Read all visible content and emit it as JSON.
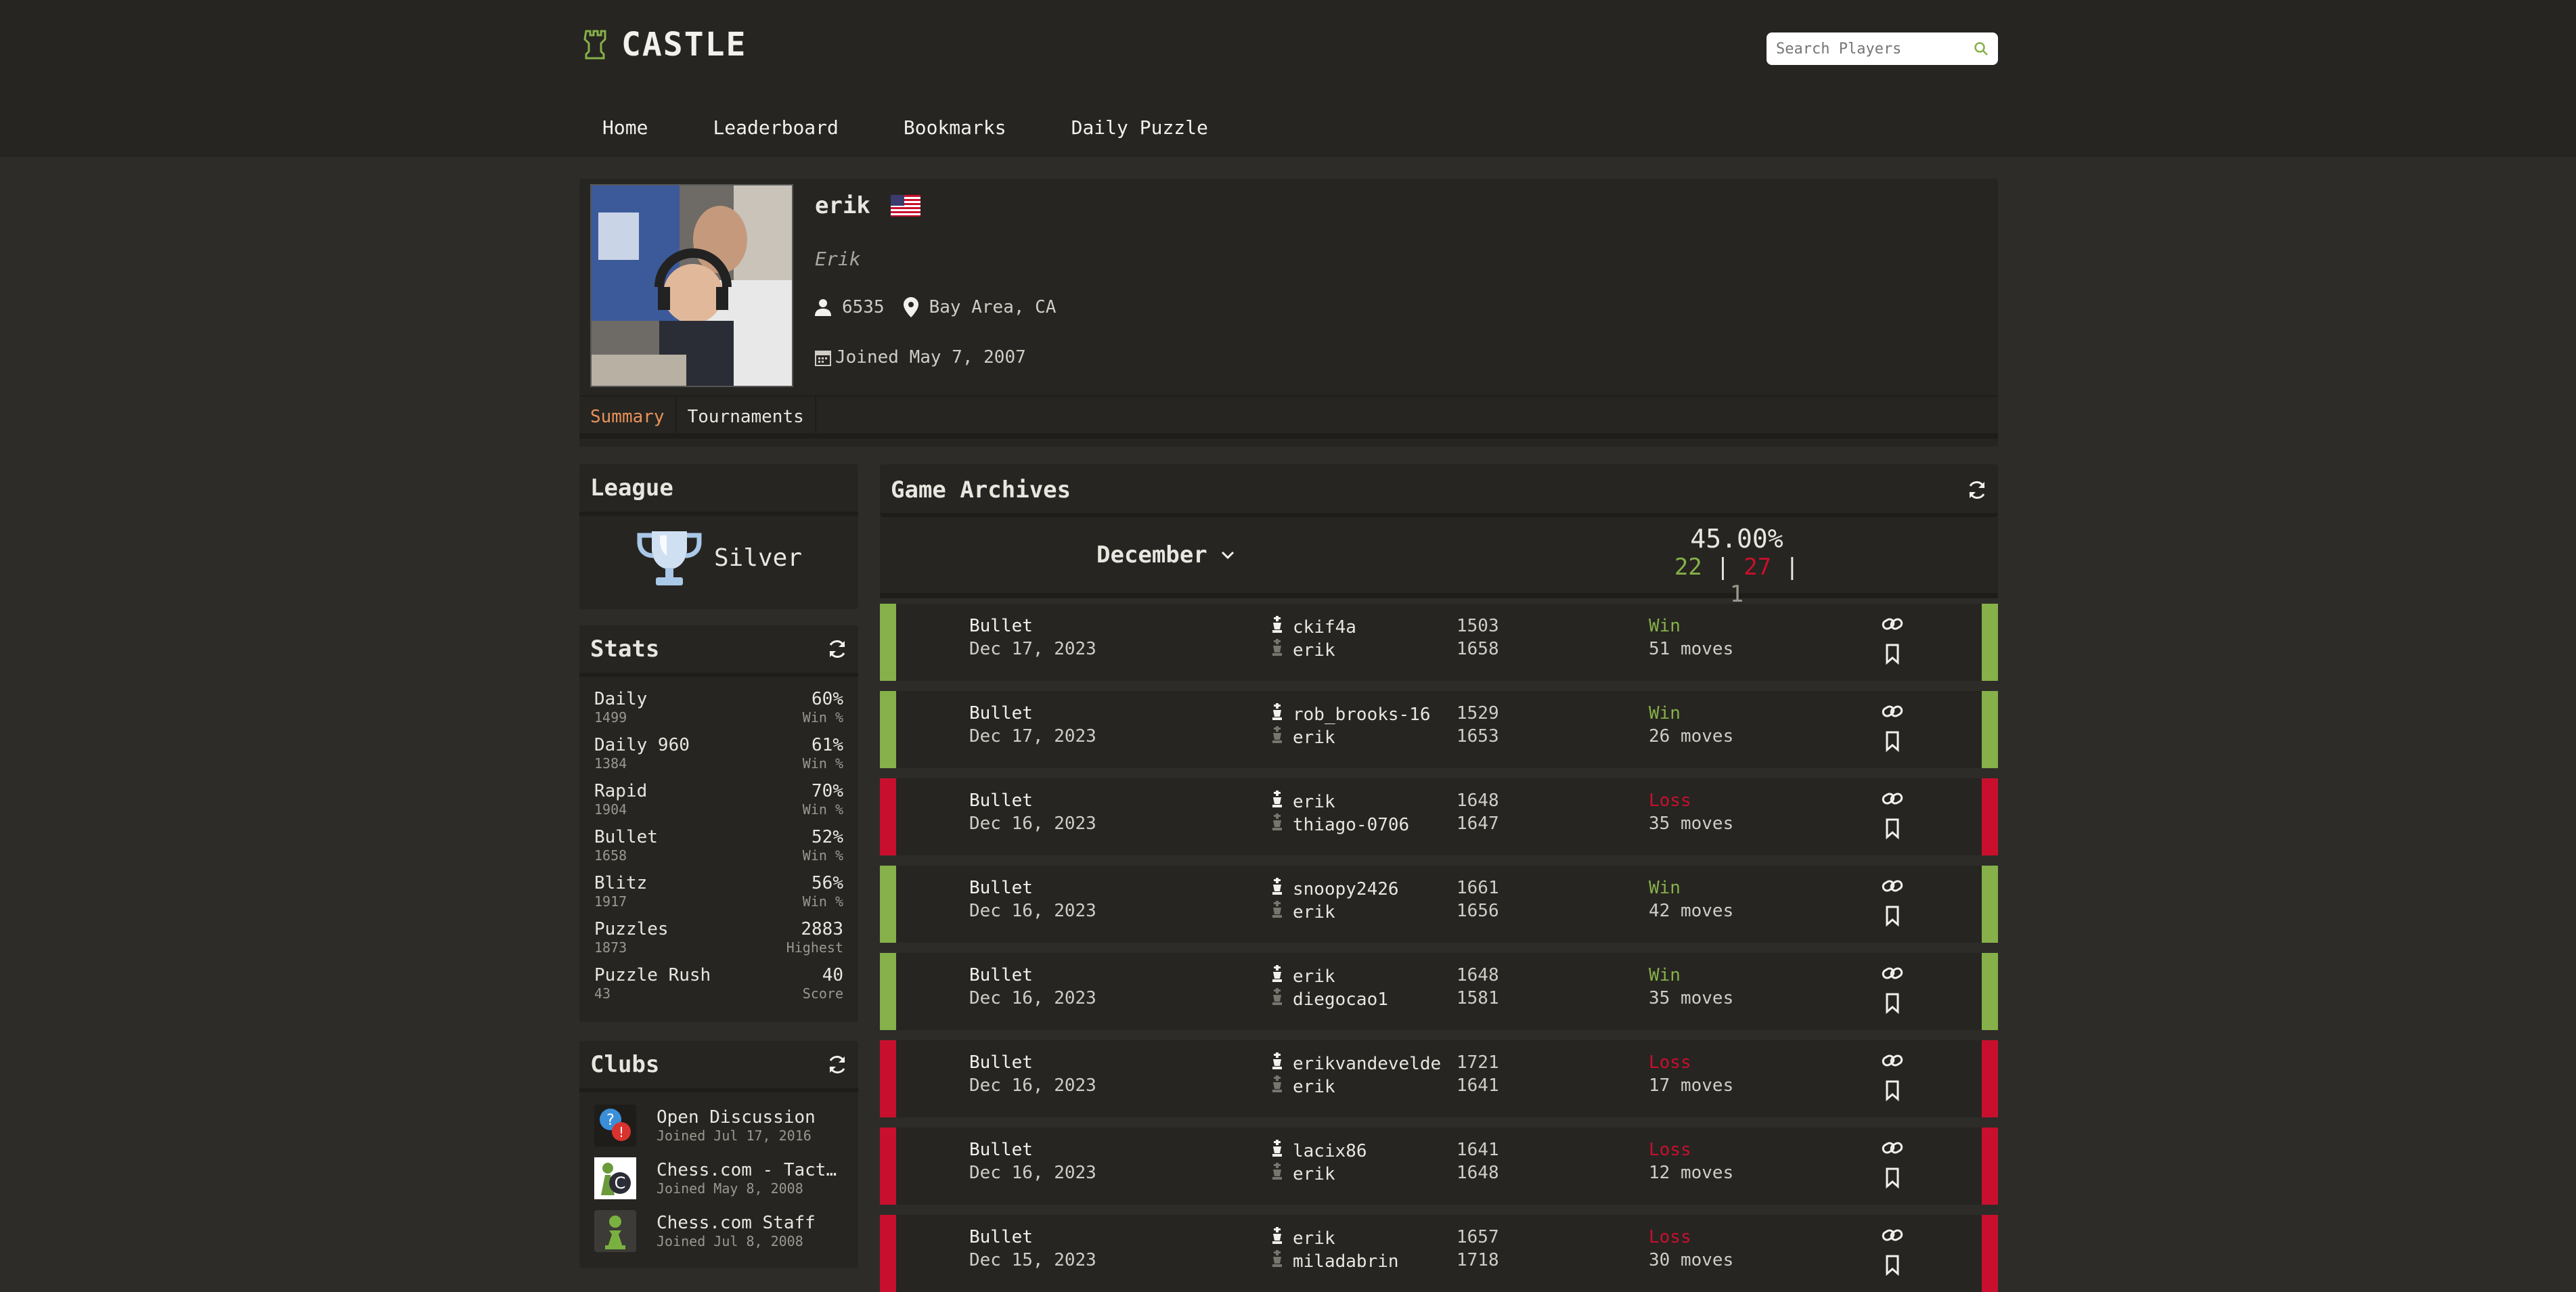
{
  "app": {
    "name": "CASTLE",
    "search_placeholder": "Search Players"
  },
  "nav": [
    {
      "label": "Home"
    },
    {
      "label": "Leaderboard"
    },
    {
      "label": "Bookmarks"
    },
    {
      "label": "Daily Puzzle"
    }
  ],
  "profile": {
    "username": "erik",
    "country_flag": "us-flag",
    "real_name": "Erik",
    "followers": "6535",
    "location": "Bay Area, CA",
    "joined": "Joined May 7, 2007",
    "tabs": [
      {
        "label": "Summary",
        "active": true
      },
      {
        "label": "Tournaments",
        "active": false
      }
    ]
  },
  "league": {
    "title": "League",
    "name": "Silver"
  },
  "stats": {
    "title": "Stats",
    "items": [
      {
        "name": "Daily",
        "rating": "1499",
        "value": "60%",
        "label": "Win %"
      },
      {
        "name": "Daily 960",
        "rating": "1384",
        "value": "61%",
        "label": "Win %"
      },
      {
        "name": "Rapid",
        "rating": "1904",
        "value": "70%",
        "label": "Win %"
      },
      {
        "name": "Bullet",
        "rating": "1658",
        "value": "52%",
        "label": "Win %"
      },
      {
        "name": "Blitz",
        "rating": "1917",
        "value": "56%",
        "label": "Win %"
      },
      {
        "name": "Puzzles",
        "rating": "1873",
        "value": "2883",
        "label": "Highest"
      },
      {
        "name": "Puzzle Rush",
        "rating": "43",
        "value": "40",
        "label": "Score"
      }
    ]
  },
  "clubs": {
    "title": "Clubs",
    "items": [
      {
        "name": "Open Discussion",
        "joined": "Joined Jul 17, 2016",
        "icon": "discussion-icon"
      },
      {
        "name": "Chess.com - Tact…",
        "joined": "Joined May 8, 2008",
        "icon": "tactics-club-icon"
      },
      {
        "name": "Chess.com Staff",
        "joined": "Joined Jul 8, 2008",
        "icon": "pawn-icon"
      }
    ]
  },
  "archives": {
    "title": "Game Archives",
    "month": "December",
    "win_pct": "45.00%",
    "wins": "22",
    "losses": "27",
    "draws": "1",
    "sep": "|"
  },
  "games": [
    {
      "type": "Bullet",
      "date": "Dec 17, 2023",
      "white": "ckif4a",
      "white_rating": "1503",
      "black": "erik",
      "black_rating": "1658",
      "result": "Win",
      "moves": "51 moves"
    },
    {
      "type": "Bullet",
      "date": "Dec 17, 2023",
      "white": "rob_brooks-16",
      "white_rating": "1529",
      "black": "erik",
      "black_rating": "1653",
      "result": "Win",
      "moves": "26 moves"
    },
    {
      "type": "Bullet",
      "date": "Dec 16, 2023",
      "white": "erik",
      "white_rating": "1648",
      "black": "thiago-0706",
      "black_rating": "1647",
      "result": "Loss",
      "moves": "35 moves"
    },
    {
      "type": "Bullet",
      "date": "Dec 16, 2023",
      "white": "snoopy2426",
      "white_rating": "1661",
      "black": "erik",
      "black_rating": "1656",
      "result": "Win",
      "moves": "42 moves"
    },
    {
      "type": "Bullet",
      "date": "Dec 16, 2023",
      "white": "erik",
      "white_rating": "1648",
      "black": "diegocao1",
      "black_rating": "1581",
      "result": "Win",
      "moves": "35 moves"
    },
    {
      "type": "Bullet",
      "date": "Dec 16, 2023",
      "white": "erikvandevelde",
      "white_rating": "1721",
      "black": "erik",
      "black_rating": "1641",
      "result": "Loss",
      "moves": "17 moves"
    },
    {
      "type": "Bullet",
      "date": "Dec 16, 2023",
      "white": "lacix86",
      "white_rating": "1641",
      "black": "erik",
      "black_rating": "1648",
      "result": "Loss",
      "moves": "12 moves"
    },
    {
      "type": "Bullet",
      "date": "Dec 15, 2023",
      "white": "erik",
      "white_rating": "1657",
      "black": "miladabrin",
      "black_rating": "1718",
      "result": "Loss",
      "moves": "30 moves"
    }
  ],
  "colors": {
    "win": "#86b049",
    "loss": "#c8102e",
    "draw": "#9a988f",
    "accent": "#e8935a",
    "logo": "#86b049"
  }
}
